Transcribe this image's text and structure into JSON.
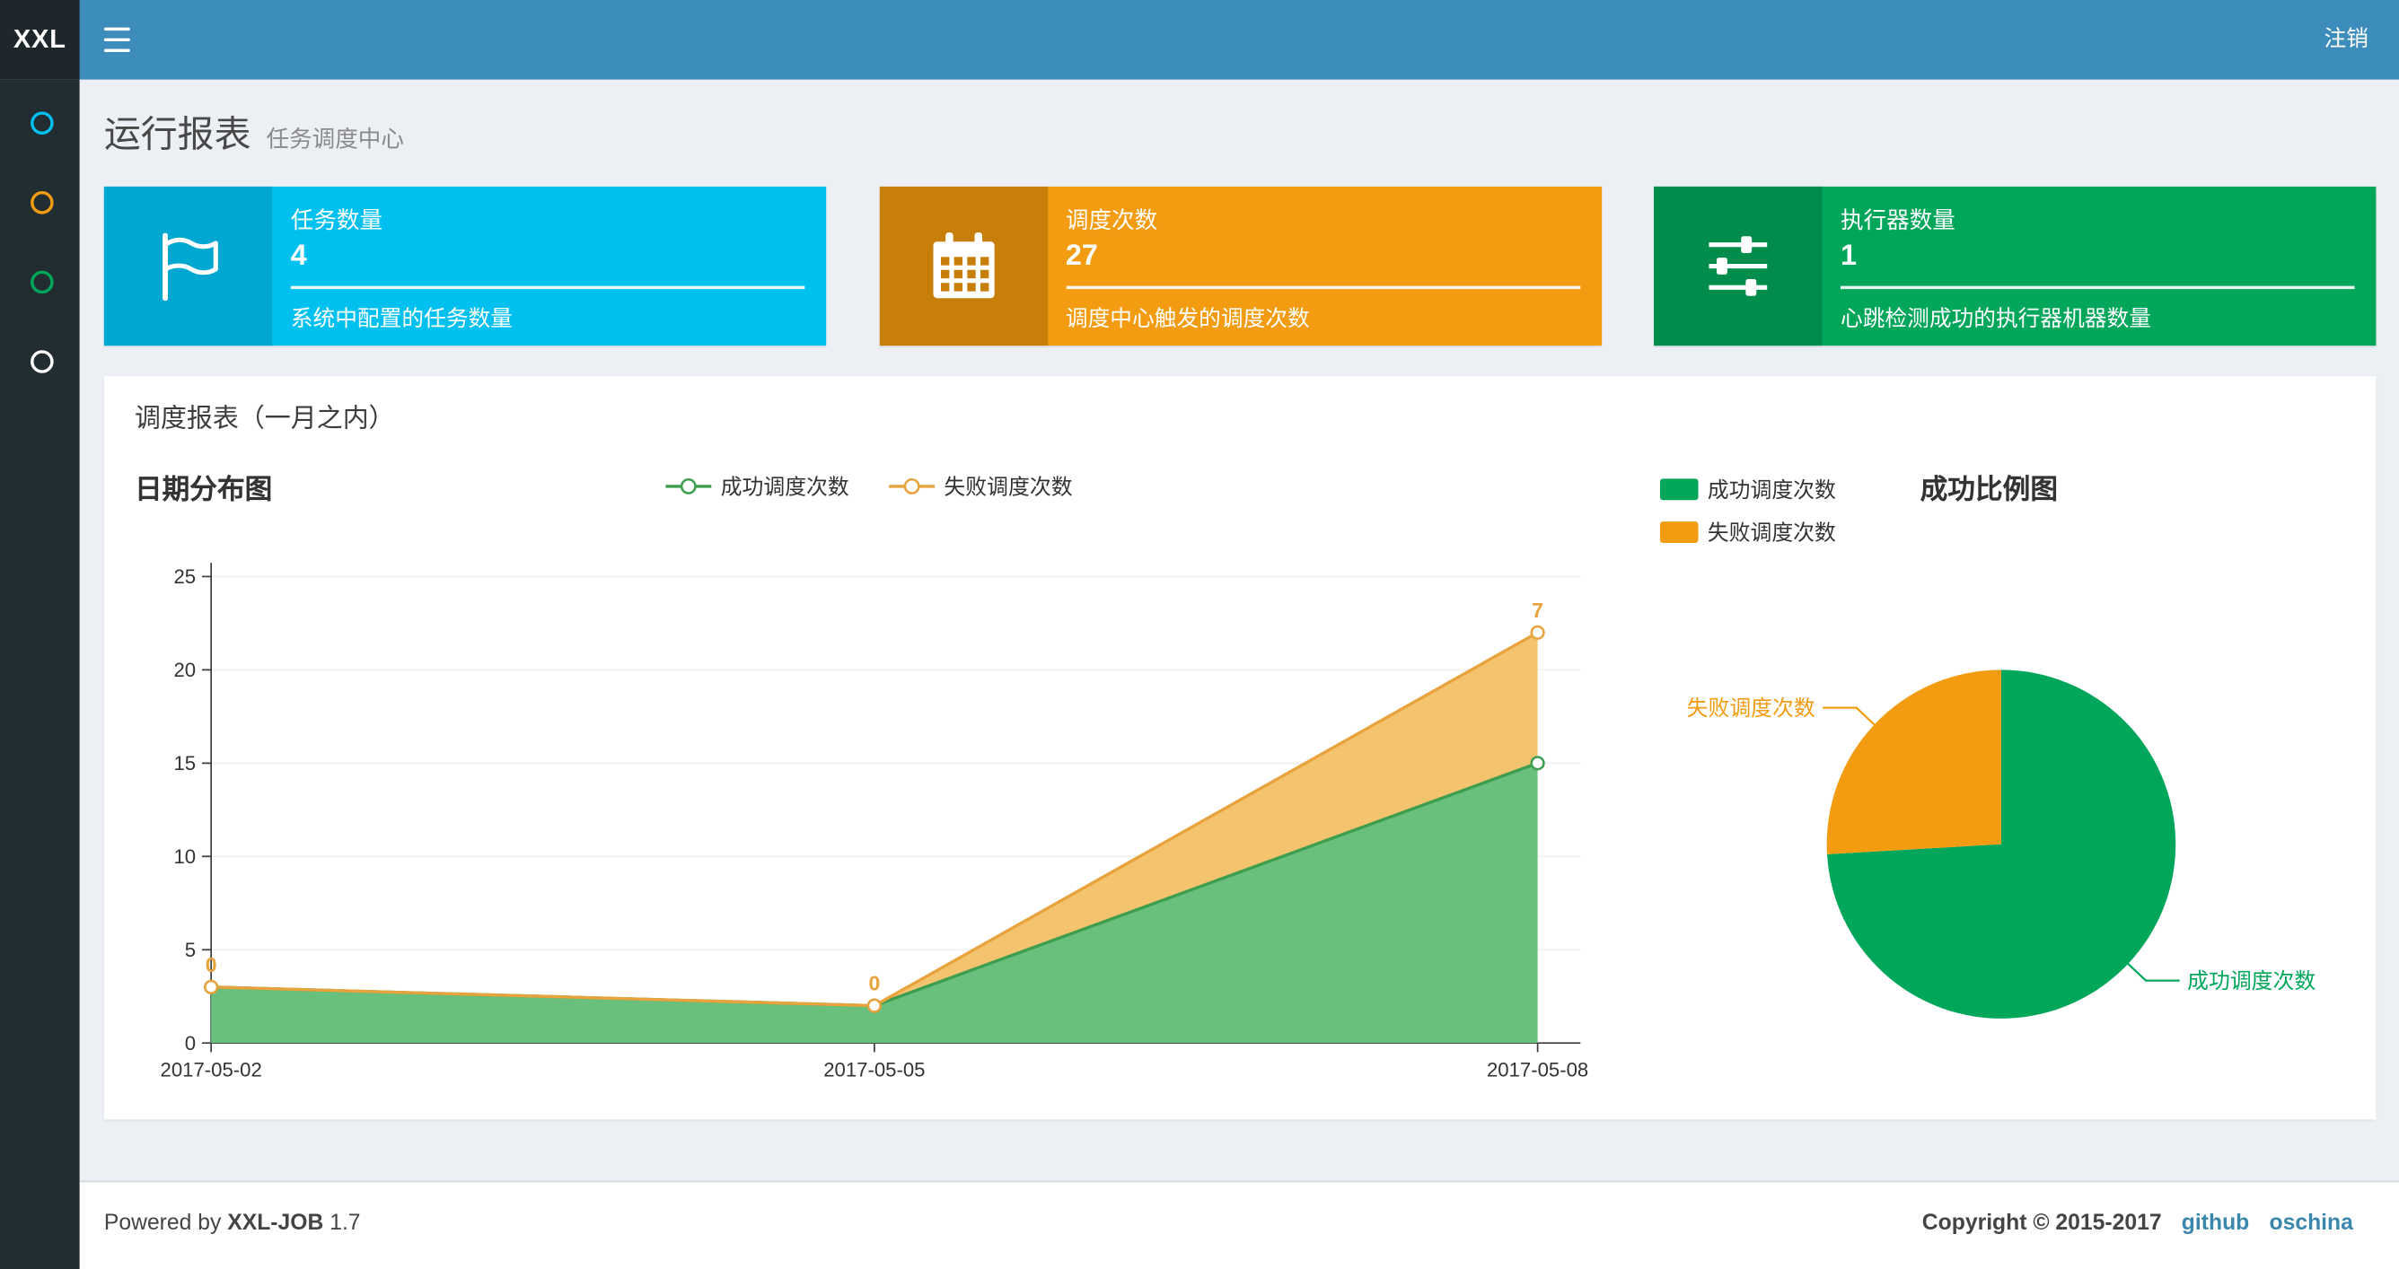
{
  "navbar": {
    "logo": "XXL",
    "logout": "注销"
  },
  "sidebar": {
    "items": [
      {
        "name": "sidebar-item-1",
        "icon": "circle-o-icon",
        "color": "#00c0ef"
      },
      {
        "name": "sidebar-item-2",
        "icon": "circle-o-icon",
        "color": "#f39c12"
      },
      {
        "name": "sidebar-item-3",
        "icon": "circle-o-icon",
        "color": "#00a65a"
      },
      {
        "name": "sidebar-item-4",
        "icon": "circle-o-icon",
        "color": "#ffffff"
      }
    ]
  },
  "page": {
    "title": "运行报表",
    "subtitle": "任务调度中心"
  },
  "info_boxes": [
    {
      "icon": "flag-icon",
      "title": "任务数量",
      "value": "4",
      "desc": "系统中配置的任务数量",
      "color": "#00c0ef",
      "icon_color": "#00a7d0"
    },
    {
      "icon": "calendar-icon",
      "title": "调度次数",
      "value": "27",
      "desc": "调度中心触发的调度次数",
      "color": "#f39c12",
      "icon_color": "#c87f0a"
    },
    {
      "icon": "sliders-icon",
      "title": "执行器数量",
      "value": "1",
      "desc": "心跳检测成功的执行器机器数量",
      "color": "#00a65a",
      "icon_color": "#008d4c"
    }
  ],
  "panel": {
    "title": "调度报表（一月之内）"
  },
  "chart_data": [
    {
      "type": "area",
      "title": "日期分布图",
      "x": [
        "2017-05-02",
        "2017-05-05",
        "2017-05-08"
      ],
      "ylim": [
        0,
        25
      ],
      "yticks": [
        0,
        5,
        10,
        15,
        20,
        25
      ],
      "stacked": true,
      "grid": true,
      "legend_position": "top",
      "legend": [
        "成功调度次数",
        "失败调度次数"
      ],
      "series": [
        {
          "name": "成功调度次数",
          "values": [
            3,
            2,
            15
          ],
          "line_color": "#3d9e50",
          "fill_color": "#68c07c"
        },
        {
          "name": "失败调度次数",
          "values": [
            0,
            0,
            7
          ],
          "line_color": "#e8a33d",
          "fill_color": "#f4c36d"
        }
      ],
      "point_labels": [
        "0",
        "0",
        "7"
      ]
    },
    {
      "type": "pie",
      "title": "成功比例图",
      "legend": [
        "成功调度次数",
        "失败调度次数"
      ],
      "slices": [
        {
          "label": "成功调度次数",
          "value": 20,
          "color": "#00a65a"
        },
        {
          "label": "失败调度次数",
          "value": 7,
          "color": "#f39c12"
        }
      ]
    }
  ],
  "footer": {
    "powered_prefix": "Powered by",
    "product": "XXL-JOB",
    "version": "1.7",
    "copyright": "Copyright © 2015-2017",
    "links": [
      "github",
      "oschina"
    ]
  }
}
